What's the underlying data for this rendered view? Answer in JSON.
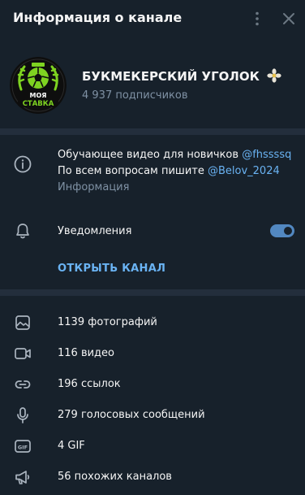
{
  "header": {
    "title": "Информация о канале",
    "more_icon": "more-vertical-icon",
    "close_icon": "close-icon"
  },
  "channel": {
    "name": "БУКМЕКЕРСКИЙ УГОЛОК",
    "subscribers": "4 937 подписчиков",
    "avatar_text_top": "МОЯ",
    "avatar_text_bottom": "СТАВКА"
  },
  "description": {
    "line1_text": "Обучающее видео для новичков ",
    "line1_link": "@fhssssq",
    "line2_text": "По всем вопросам пишите ",
    "line2_link": "@Belov_2024",
    "caption": "Информация"
  },
  "notifications": {
    "label": "Уведомления",
    "enabled": true
  },
  "open_channel_label": "ОТКРЫТЬ КАНАЛ",
  "media": [
    {
      "icon": "photo-icon",
      "label": "1139 фотографий"
    },
    {
      "icon": "video-icon",
      "label": "116 видео"
    },
    {
      "icon": "link-icon",
      "label": "196 ссылок"
    },
    {
      "icon": "microphone-icon",
      "label": "279 голосовых сообщений"
    },
    {
      "icon": "gif-icon",
      "label": "4 GIF"
    },
    {
      "icon": "megaphone-icon",
      "label": "56 похожих каналов"
    }
  ],
  "colors": {
    "background": "#17212b",
    "separator": "#232e3c",
    "accent": "#6ab3f3",
    "toggle": "#5288c1",
    "muted_text": "#7f91a4",
    "avatar_green": "#7ed321"
  }
}
